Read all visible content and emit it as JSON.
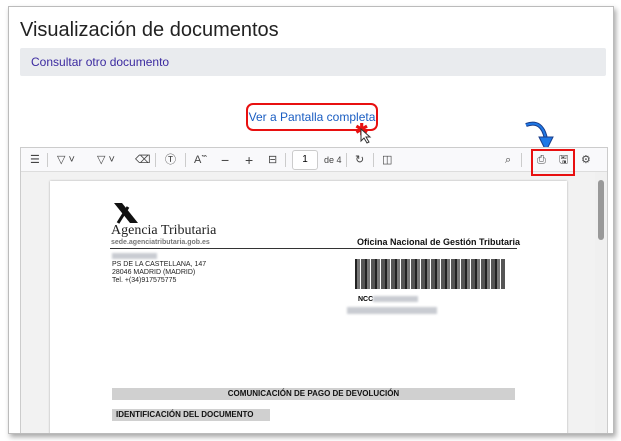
{
  "page": {
    "title": "Visualización de documentos",
    "other_link": "Consultar otro documento",
    "fullscreen_link": "Ver a Pantalla completa"
  },
  "toolbar": {
    "page_number": "1",
    "page_total": "de 4"
  },
  "document": {
    "org": "Agencia Tributaria",
    "site": "sede.agenciatributaria.gob.es",
    "office": "Oficina Nacional de Gestión Tributaria",
    "address": [
      "PS DE LA CASTELLANA, 147",
      "28046 MADRID (MADRID)",
      "Tel. +(34)917575775"
    ],
    "ncc_label": "NCC",
    "heading": "COMUNICACIÓN DE PAGO DE DEVOLUCIÓN",
    "section": "IDENTIFICACIÓN DEL DOCUMENTO"
  },
  "colors": {
    "highlight": "#e81010",
    "link": "#1a5dc2"
  }
}
